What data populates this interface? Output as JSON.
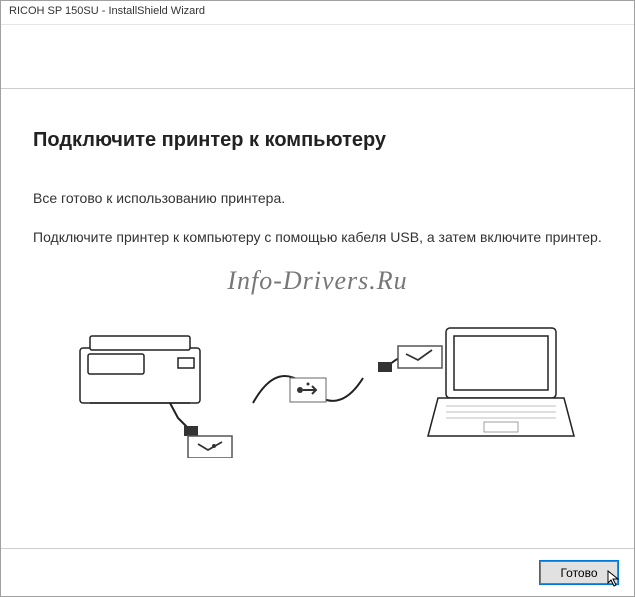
{
  "titlebar": {
    "title": "RICOH SP 150SU - InstallShield Wizard"
  },
  "content": {
    "heading": "Подключите принтер к компьютеру",
    "line1": "Все готово к использованию принтера.",
    "line2": "Подключите принтер к компьютеру с помощью кабеля USB, а затем включите принтер."
  },
  "watermark": "Info-Drivers.Ru",
  "footer": {
    "finish_label": "Готово"
  }
}
